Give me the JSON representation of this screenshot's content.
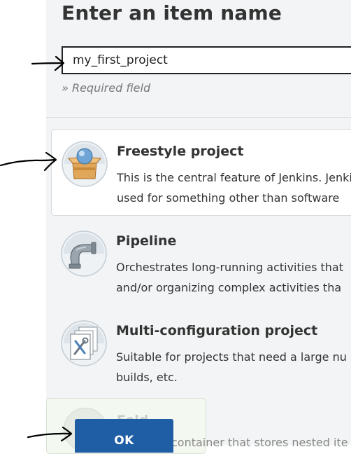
{
  "page": {
    "title": "Enter an item name"
  },
  "name_field": {
    "value": "my_first_project",
    "hint": "» Required field"
  },
  "items": [
    {
      "icon": "freestyle-project-icon",
      "title": "Freestyle project",
      "description_lines": [
        "This is the central feature of Jenkins. Jenki",
        "used for something other than software"
      ],
      "selected": true
    },
    {
      "icon": "pipeline-icon",
      "title": "Pipeline",
      "description_lines": [
        "Orchestrates long-running activities that",
        "and/or organizing complex activities tha"
      ],
      "selected": false
    },
    {
      "icon": "multi-configuration-icon",
      "title": "Multi-configuration project",
      "description_lines": [
        "Suitable for projects that need a large nu",
        "builds, etc."
      ],
      "selected": false
    },
    {
      "icon": "folder-icon",
      "title": "Fold",
      "description": "container that stores nested ite",
      "selected": false
    }
  ],
  "ok_button": {
    "label": "OK"
  },
  "colors": {
    "header_bg": "#f2f4f5",
    "primary_button": "#1f5da5",
    "text": "#333333",
    "hint": "#777777"
  }
}
